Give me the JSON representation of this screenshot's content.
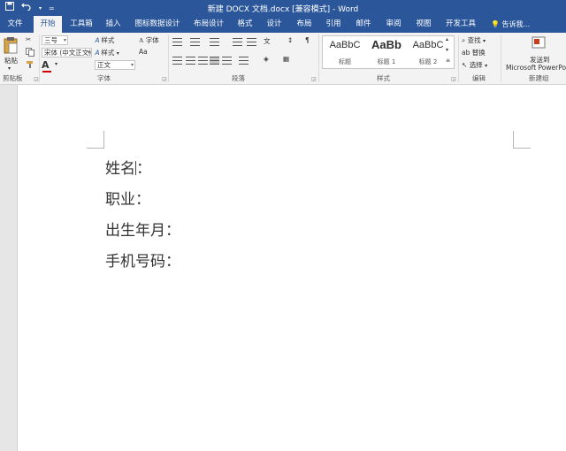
{
  "titlebar": {
    "title": "新建 DOCX 文档.docx [兼容模式] - Word",
    "save_icon": "floppy-icon",
    "undo_icon": "undo-icon",
    "qat_more": "="
  },
  "tabs": [
    {
      "label": "文件"
    },
    {
      "label": "开始",
      "active": true
    },
    {
      "label": "工具箱"
    },
    {
      "label": "插入"
    },
    {
      "label": "图标数据设计"
    },
    {
      "label": "布局设计"
    },
    {
      "label": "格式"
    },
    {
      "label": "设计"
    },
    {
      "label": "布局"
    },
    {
      "label": "引用"
    },
    {
      "label": "邮件"
    },
    {
      "label": "审阅"
    },
    {
      "label": "视图"
    },
    {
      "label": "开发工具"
    }
  ],
  "tell_me": "告诉我...",
  "ribbon": {
    "clipboard": {
      "paste": "粘贴",
      "label": "剪贴板"
    },
    "font": {
      "size_value": "三号",
      "font_value": "宋体 (中文正文)",
      "style_value": "正文",
      "style_btn": "样式",
      "style_btn2": "样式",
      "font_btn": "字体",
      "aa": "Aa",
      "label": "字体",
      "font_color_letter": "A"
    },
    "paragraph": {
      "label": "段落"
    },
    "styles": {
      "items": [
        {
          "preview": "AaBbC",
          "name": "标题"
        },
        {
          "preview": "AaBb",
          "name": "标题 1"
        },
        {
          "preview": "AaBbC",
          "name": "标题 2"
        }
      ],
      "label": "样式"
    },
    "editing": {
      "find": "查找",
      "replace": "替换",
      "select": "选择",
      "label": "编辑"
    },
    "new_group": {
      "line1": "发送到",
      "line2": "Microsoft PowerPoint",
      "label": "新建组"
    }
  },
  "document": {
    "lines": [
      "姓名",
      "：",
      "职业：",
      "出生年月：",
      "手机号码："
    ]
  },
  "colors": {
    "accent": "#2b579a",
    "font_color_bar": "#d00000"
  }
}
